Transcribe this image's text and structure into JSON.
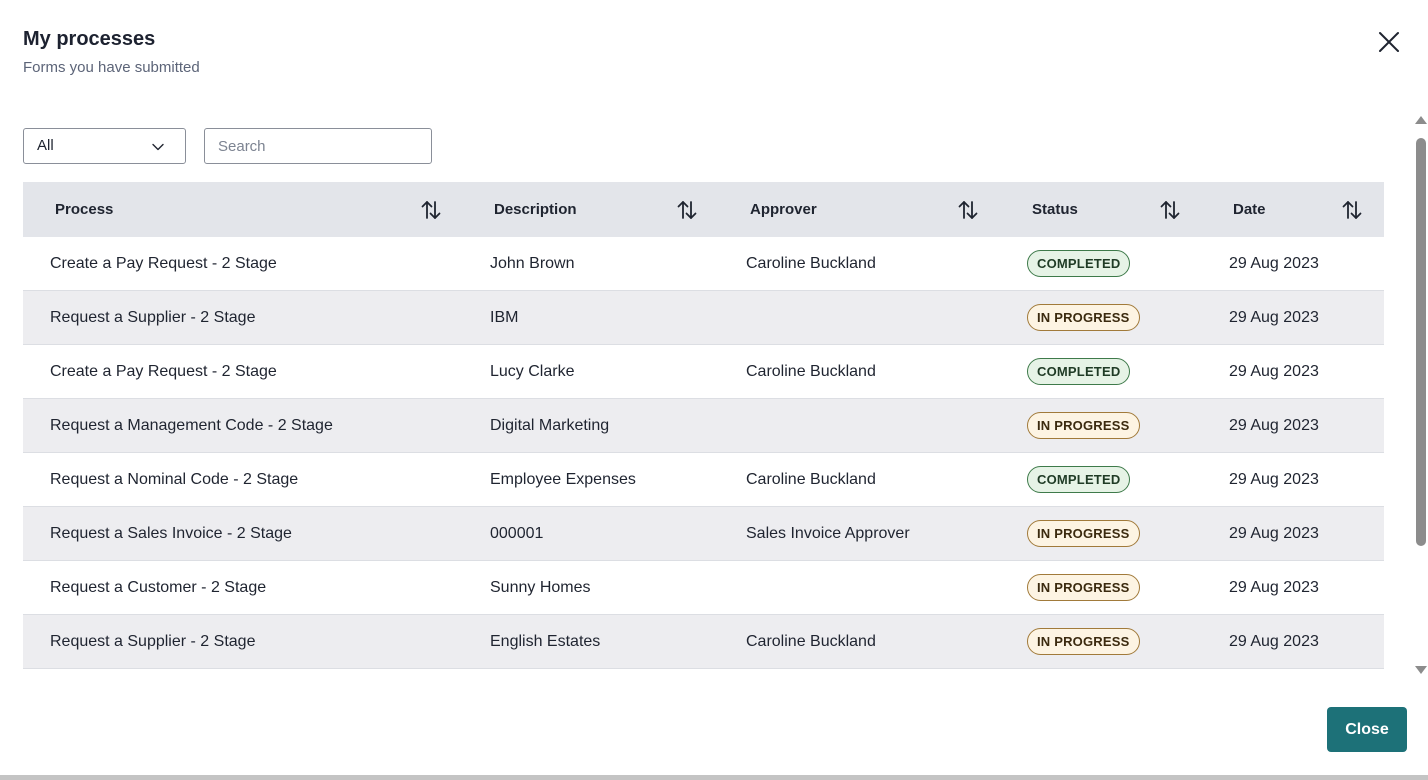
{
  "header": {
    "title": "My processes",
    "subtitle": "Forms you have submitted"
  },
  "filters": {
    "status_selected": "All",
    "search_placeholder": "Search"
  },
  "table": {
    "columns": [
      "Process",
      "Description",
      "Approver",
      "Status",
      "Date"
    ],
    "rows": [
      {
        "process": "Create a Pay Request - 2 Stage",
        "description": "John Brown",
        "approver": "Caroline Buckland",
        "status": "COMPLETED",
        "date": "29 Aug 2023"
      },
      {
        "process": "Request a Supplier - 2 Stage",
        "description": "IBM",
        "approver": "",
        "status": "IN PROGRESS",
        "date": "29 Aug 2023"
      },
      {
        "process": "Create a Pay Request - 2 Stage",
        "description": "Lucy Clarke",
        "approver": "Caroline Buckland",
        "status": "COMPLETED",
        "date": "29 Aug 2023"
      },
      {
        "process": "Request a Management Code - 2 Stage",
        "description": "Digital Marketing",
        "approver": "",
        "status": "IN PROGRESS",
        "date": "29 Aug 2023"
      },
      {
        "process": "Request a Nominal Code - 2 Stage",
        "description": "Employee Expenses",
        "approver": "Caroline Buckland",
        "status": "COMPLETED",
        "date": "29 Aug 2023"
      },
      {
        "process": "Request a Sales Invoice - 2 Stage",
        "description": "000001",
        "approver": "Sales Invoice Approver",
        "status": "IN PROGRESS",
        "date": "29 Aug 2023"
      },
      {
        "process": "Request a Customer - 2 Stage",
        "description": "Sunny Homes",
        "approver": "",
        "status": "IN PROGRESS",
        "date": "29 Aug 2023"
      },
      {
        "process": "Request a Supplier - 2 Stage",
        "description": "English Estates",
        "approver": "Caroline Buckland",
        "status": "IN PROGRESS",
        "date": "29 Aug 2023"
      }
    ]
  },
  "footer": {
    "close_label": "Close"
  },
  "icons": {
    "close": "close-icon",
    "dropdown": "chevron-down-icon",
    "sort": "sort-icon"
  },
  "colors": {
    "primary": "#1d7178",
    "header_bg": "#e3e5ea",
    "row_alt": "#ededf0",
    "completed_bg": "#e6f3e6",
    "completed_border": "#3e7a4a",
    "inprogress_bg": "#fdf4e3",
    "inprogress_border": "#a17a3a"
  }
}
